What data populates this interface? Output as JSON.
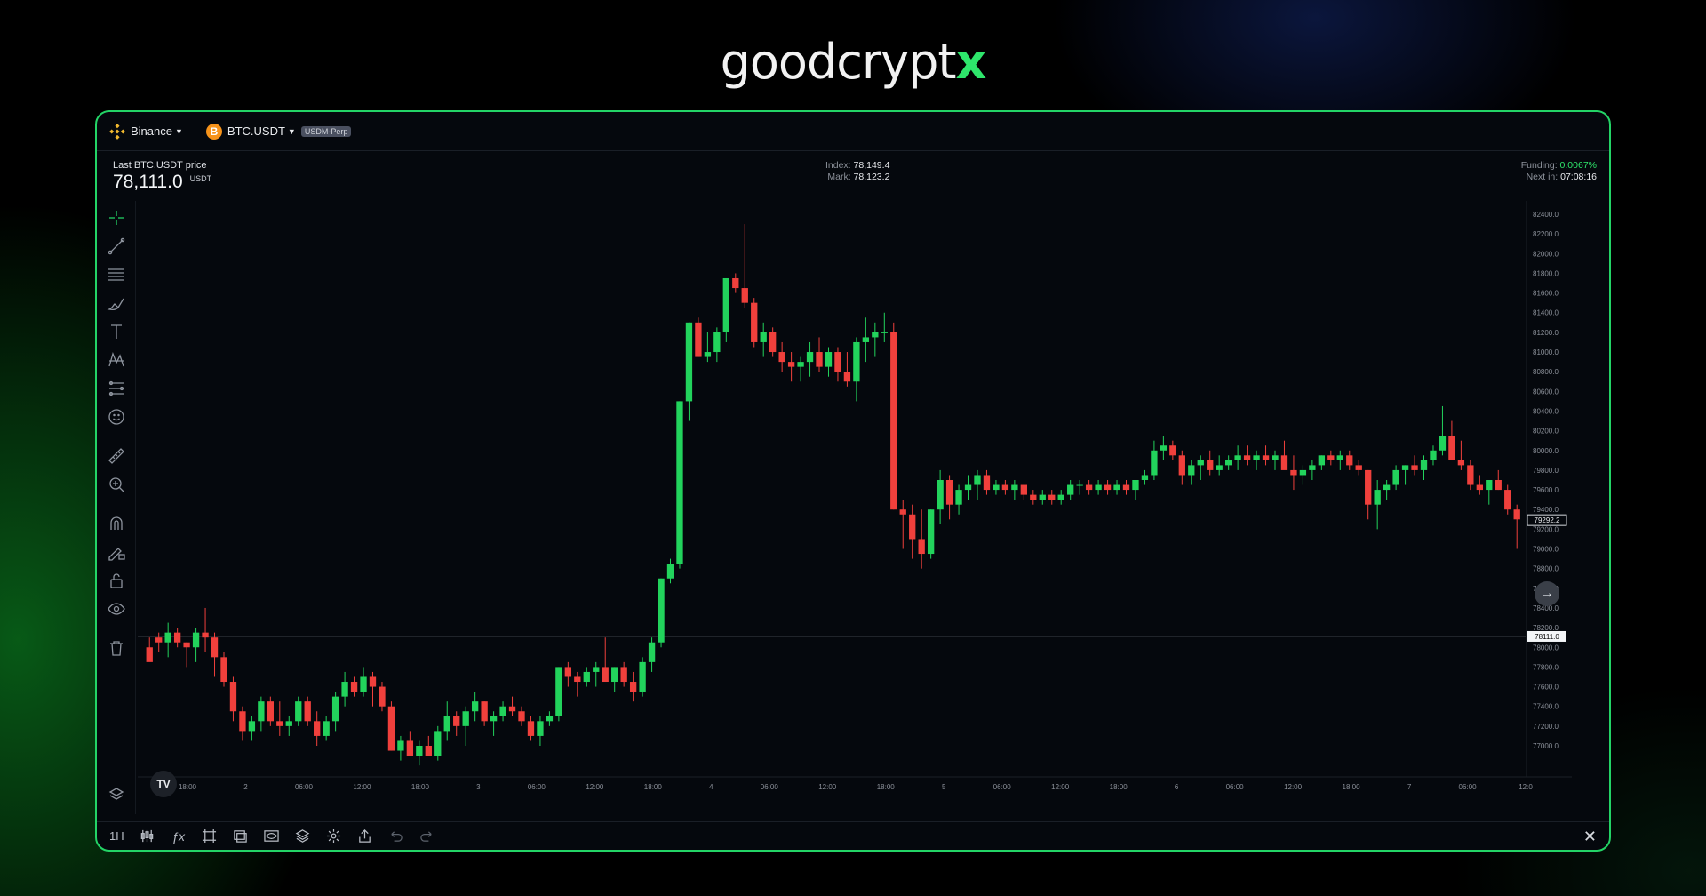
{
  "brand": {
    "name_main": "goodcrypt",
    "name_accent": "x"
  },
  "topbar": {
    "exchange": "Binance",
    "pair": "BTC.USDT",
    "pair_tag": "USDM-Perp",
    "btc_icon_glyph": "B"
  },
  "info": {
    "last_price_label": "Last BTC.USDT price",
    "last_price": "78,111.0",
    "last_price_unit": "USDT",
    "index_label": "Index:",
    "index_value": "78,149.4",
    "mark_label": "Mark:",
    "mark_value": "78,123.2",
    "funding_label": "Funding:",
    "funding_value": "0.0067%",
    "next_label": "Next in:",
    "next_value": "07:08:16"
  },
  "left_tools": [
    "crosshair-icon",
    "trend-line-icon",
    "fib-lines-icon",
    "brush-icon",
    "text-icon",
    "pattern-icon",
    "prediction-icon",
    "emoji-icon",
    "ruler-icon",
    "zoom-in-icon",
    "magnet-icon",
    "lock-drawing-icon",
    "lock-icon",
    "eye-icon",
    "trash-icon"
  ],
  "bottombar": {
    "interval": "1H",
    "tv_logo": "TV"
  },
  "colors": {
    "up": "#22d35c",
    "down": "#f0403c",
    "accent": "#23d466",
    "bg": "#05080d"
  },
  "chart_data": {
    "type": "candlestick",
    "price_axis_ticks": [
      "82400.0",
      "82200.0",
      "82000.0",
      "81800.0",
      "81600.0",
      "81400.0",
      "81200.0",
      "81000.0",
      "80800.0",
      "80600.0",
      "80400.0",
      "80200.0",
      "80000.0",
      "79800.0",
      "79600.0",
      "79400.0",
      "79200.0",
      "79000.0",
      "78800.0",
      "78600.0",
      "78400.0",
      "78200.0",
      "78000.0",
      "77800.0",
      "77600.0",
      "77400.0",
      "77200.0",
      "77000.0"
    ],
    "time_axis_ticks": [
      "18:00",
      "2",
      "06:00",
      "12:00",
      "18:00",
      "3",
      "06:00",
      "12:00",
      "18:00",
      "4",
      "06:00",
      "12:00",
      "18:00",
      "5",
      "06:00",
      "12:00",
      "18:00",
      "6",
      "06:00",
      "12:00",
      "18:00",
      "7",
      "06:00",
      "12:0"
    ],
    "ylim": [
      77000,
      82400
    ],
    "last_price_label": "78111.0",
    "last_price_value": 78111.0,
    "crosshair_label": "79292.2",
    "crosshair_value": 79292.2,
    "candles": [
      [
        78000,
        78100,
        77900,
        77850
      ],
      [
        78100,
        78150,
        77950,
        78050
      ],
      [
        78050,
        78250,
        77900,
        78150
      ],
      [
        78150,
        78200,
        78000,
        78050
      ],
      [
        78050,
        78050,
        77800,
        78000
      ],
      [
        78000,
        78200,
        77850,
        78150
      ],
      [
        78150,
        78400,
        77950,
        78100
      ],
      [
        78100,
        78150,
        77700,
        77900
      ],
      [
        77900,
        77950,
        77600,
        77650
      ],
      [
        77650,
        77700,
        77250,
        77350
      ],
      [
        77350,
        77400,
        77050,
        77150
      ],
      [
        77150,
        77300,
        77050,
        77250
      ],
      [
        77250,
        77500,
        77150,
        77450
      ],
      [
        77450,
        77500,
        77200,
        77250
      ],
      [
        77250,
        77450,
        77100,
        77200
      ],
      [
        77200,
        77300,
        77100,
        77250
      ],
      [
        77250,
        77500,
        77200,
        77450
      ],
      [
        77450,
        77500,
        77200,
        77250
      ],
      [
        77250,
        77350,
        77000,
        77100
      ],
      [
        77100,
        77300,
        77050,
        77250
      ],
      [
        77250,
        77550,
        77150,
        77500
      ],
      [
        77500,
        77750,
        77400,
        77650
      ],
      [
        77650,
        77700,
        77500,
        77550
      ],
      [
        77550,
        77800,
        77500,
        77700
      ],
      [
        77700,
        77750,
        77400,
        77600
      ],
      [
        77600,
        77650,
        77350,
        77400
      ],
      [
        77400,
        77450,
        76950,
        76950
      ],
      [
        76950,
        77100,
        76850,
        77050
      ],
      [
        77050,
        77150,
        76900,
        76900
      ],
      [
        76900,
        77050,
        76800,
        77000
      ],
      [
        77000,
        77100,
        76900,
        76900
      ],
      [
        76900,
        77200,
        76850,
        77150
      ],
      [
        77150,
        77450,
        77050,
        77300
      ],
      [
        77300,
        77350,
        77100,
        77200
      ],
      [
        77200,
        77400,
        77000,
        77350
      ],
      [
        77350,
        77550,
        77250,
        77450
      ],
      [
        77450,
        77450,
        77200,
        77250
      ],
      [
        77250,
        77350,
        77100,
        77300
      ],
      [
        77300,
        77450,
        77250,
        77400
      ],
      [
        77400,
        77500,
        77300,
        77350
      ],
      [
        77350,
        77400,
        77200,
        77250
      ],
      [
        77250,
        77300,
        77050,
        77100
      ],
      [
        77100,
        77300,
        77000,
        77250
      ],
      [
        77250,
        77350,
        77200,
        77300
      ],
      [
        77300,
        77800,
        77250,
        77800
      ],
      [
        77800,
        77850,
        77600,
        77700
      ],
      [
        77700,
        77750,
        77500,
        77650
      ],
      [
        77650,
        77800,
        77600,
        77750
      ],
      [
        77750,
        77850,
        77600,
        77800
      ],
      [
        77800,
        78100,
        77650,
        77650
      ],
      [
        77650,
        77800,
        77550,
        77800
      ],
      [
        77800,
        77850,
        77600,
        77650
      ],
      [
        77650,
        77750,
        77450,
        77550
      ],
      [
        77550,
        77900,
        77500,
        77850
      ],
      [
        77850,
        78100,
        77750,
        78050
      ],
      [
        78050,
        78700,
        78000,
        78700
      ],
      [
        78700,
        78900,
        78650,
        78850
      ],
      [
        78850,
        80500,
        78800,
        80500
      ],
      [
        80500,
        81300,
        80300,
        81300
      ],
      [
        81300,
        81350,
        80950,
        80950
      ],
      [
        80950,
        81200,
        80900,
        81000
      ],
      [
        81000,
        81250,
        80900,
        81200
      ],
      [
        81200,
        81750,
        81100,
        81750
      ],
      [
        81750,
        81800,
        81600,
        81650
      ],
      [
        81650,
        82300,
        81450,
        81500
      ],
      [
        81500,
        81550,
        81050,
        81100
      ],
      [
        81100,
        81300,
        80950,
        81200
      ],
      [
        81200,
        81250,
        80950,
        81000
      ],
      [
        81000,
        81100,
        80800,
        80900
      ],
      [
        80900,
        81000,
        80700,
        80850
      ],
      [
        80850,
        80950,
        80700,
        80900
      ],
      [
        80900,
        81100,
        80750,
        81000
      ],
      [
        81000,
        81150,
        80800,
        80850
      ],
      [
        80850,
        81050,
        80750,
        81000
      ],
      [
        81000,
        81050,
        80700,
        80800
      ],
      [
        80800,
        81000,
        80650,
        80700
      ],
      [
        80700,
        81150,
        80500,
        81100
      ],
      [
        81100,
        81350,
        80900,
        81150
      ],
      [
        81150,
        81300,
        80950,
        81200
      ],
      [
        81200,
        81400,
        81100,
        81200
      ],
      [
        81200,
        81300,
        79400,
        79400
      ],
      [
        79400,
        79500,
        79000,
        79350
      ],
      [
        79350,
        79450,
        78900,
        79100
      ],
      [
        79100,
        79400,
        78800,
        78950
      ],
      [
        78950,
        79400,
        78900,
        79400
      ],
      [
        79400,
        79800,
        79250,
        79700
      ],
      [
        79700,
        79750,
        79300,
        79450
      ],
      [
        79450,
        79650,
        79350,
        79600
      ],
      [
        79600,
        79750,
        79500,
        79650
      ],
      [
        79650,
        79800,
        79500,
        79750
      ],
      [
        79750,
        79800,
        79550,
        79600
      ],
      [
        79600,
        79700,
        79550,
        79650
      ],
      [
        79650,
        79700,
        79550,
        79600
      ],
      [
        79600,
        79700,
        79500,
        79650
      ],
      [
        79650,
        79650,
        79500,
        79550
      ],
      [
        79550,
        79600,
        79450,
        79500
      ],
      [
        79500,
        79600,
        79450,
        79550
      ],
      [
        79550,
        79600,
        79450,
        79500
      ],
      [
        79500,
        79600,
        79450,
        79550
      ],
      [
        79550,
        79700,
        79500,
        79650
      ],
      [
        79650,
        79700,
        79550,
        79650
      ],
      [
        79650,
        79700,
        79550,
        79600
      ],
      [
        79600,
        79700,
        79550,
        79650
      ],
      [
        79650,
        79700,
        79550,
        79600
      ],
      [
        79600,
        79700,
        79550,
        79650
      ],
      [
        79650,
        79700,
        79550,
        79600
      ],
      [
        79600,
        79700,
        79500,
        79700
      ],
      [
        79700,
        79800,
        79650,
        79750
      ],
      [
        79750,
        80100,
        79700,
        80000
      ],
      [
        80000,
        80150,
        79900,
        80050
      ],
      [
        80050,
        80100,
        79900,
        79950
      ],
      [
        79950,
        80000,
        79650,
        79750
      ],
      [
        79750,
        79900,
        79650,
        79850
      ],
      [
        79850,
        79950,
        79700,
        79900
      ],
      [
        79900,
        80000,
        79750,
        79800
      ],
      [
        79800,
        79950,
        79750,
        79850
      ],
      [
        79850,
        79950,
        79800,
        79900
      ],
      [
        79900,
        80050,
        79800,
        79950
      ],
      [
        79950,
        80050,
        79850,
        79900
      ],
      [
        79900,
        80000,
        79800,
        79950
      ],
      [
        79950,
        80050,
        79850,
        79900
      ],
      [
        79900,
        80000,
        79800,
        79950
      ],
      [
        79950,
        80100,
        79900,
        79800
      ],
      [
        79800,
        79950,
        79600,
        79750
      ],
      [
        79750,
        79850,
        79650,
        79800
      ],
      [
        79800,
        79900,
        79700,
        79850
      ],
      [
        79850,
        79950,
        79800,
        79950
      ],
      [
        79950,
        80000,
        79850,
        79900
      ],
      [
        79900,
        80000,
        79800,
        79950
      ],
      [
        79950,
        80000,
        79800,
        79850
      ],
      [
        79850,
        79900,
        79750,
        79800
      ],
      [
        79800,
        79800,
        79300,
        79450
      ],
      [
        79450,
        79700,
        79200,
        79600
      ],
      [
        79600,
        79700,
        79500,
        79650
      ],
      [
        79650,
        79850,
        79600,
        79800
      ],
      [
        79800,
        79850,
        79650,
        79850
      ],
      [
        79850,
        79950,
        79750,
        79800
      ],
      [
        79800,
        79950,
        79700,
        79900
      ],
      [
        79900,
        80050,
        79850,
        80000
      ],
      [
        80000,
        80450,
        79950,
        80150
      ],
      [
        80150,
        80300,
        79900,
        79900
      ],
      [
        79900,
        80100,
        79800,
        79850
      ],
      [
        79850,
        79900,
        79600,
        79650
      ],
      [
        79650,
        79750,
        79550,
        79600
      ],
      [
        79600,
        79700,
        79450,
        79700
      ],
      [
        79700,
        79800,
        79600,
        79600
      ],
      [
        79600,
        79650,
        79350,
        79400
      ],
      [
        79400,
        79450,
        79000,
        79300
      ]
    ]
  }
}
